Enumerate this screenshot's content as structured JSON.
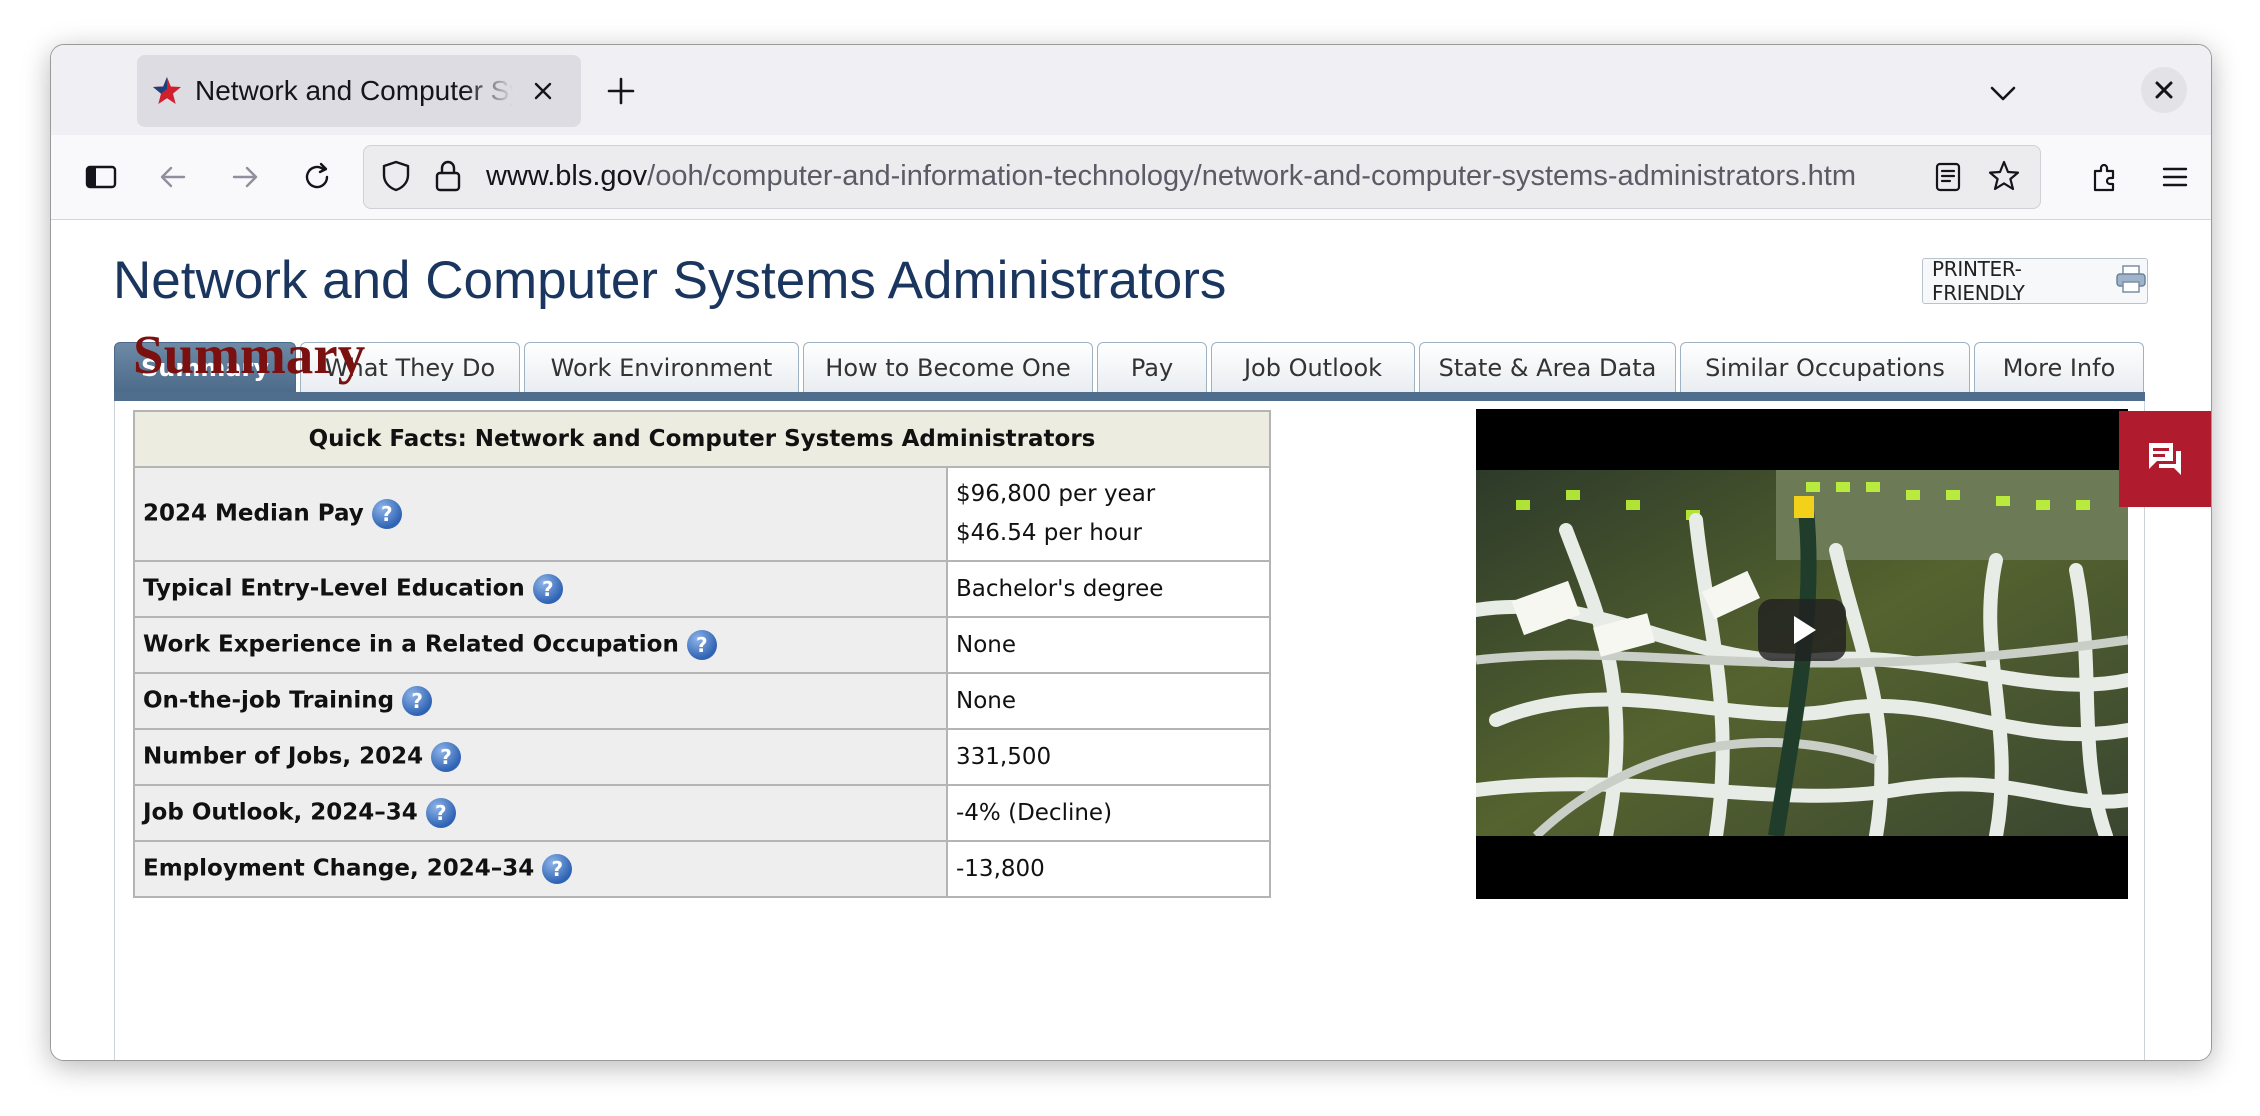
{
  "browser": {
    "tab_title": "Network and Computer Systems Administrators",
    "url_host": "www.bls.gov",
    "url_path": "/ooh/computer-and-information-technology/network-and-computer-systems-administrators.htm",
    "icons": [
      "sidebar-icon",
      "back-icon",
      "forward-icon",
      "reload-icon",
      "shield-icon",
      "lock-icon",
      "reader-view-icon",
      "bookmark-star-icon",
      "extensions-icon",
      "menu-icon",
      "list-all-tabs-icon",
      "close-window-icon",
      "new-tab-icon"
    ]
  },
  "page": {
    "title": "Network and Computer Systems Administrators",
    "printer_friendly": "PRINTER-FRIENDLY",
    "tabs": [
      "Summary",
      "What They Do",
      "Work Environment",
      "How to Become One",
      "Pay",
      "Job Outlook",
      "State & Area Data",
      "Similar Occupations",
      "More Info"
    ],
    "active_tab": "Summary",
    "section_heading": "Summary",
    "quick_facts": {
      "title": "Quick Facts: Network and Computer Systems Administrators",
      "help_glyph": "?",
      "rows": [
        {
          "label": "2024 Median Pay",
          "value": "$96,800 per year",
          "value2": "$46.54 per hour"
        },
        {
          "label": "Typical Entry-Level Education",
          "value": "Bachelor's degree"
        },
        {
          "label": "Work Experience in a Related Occupation",
          "value": "None"
        },
        {
          "label": "On-the-job Training",
          "value": "None"
        },
        {
          "label": "Number of Jobs, 2024",
          "value": "331,500"
        },
        {
          "label": "Job Outlook, 2024–34",
          "value": "-4% (Decline)"
        },
        {
          "label": "Employment Change, 2024–34",
          "value": "-13,800"
        }
      ]
    }
  },
  "colors": {
    "title_blue": "#1a355e",
    "summary_red": "#7a1010",
    "active_tab": "#4c6b8a",
    "chat_red": "#b01c2e"
  }
}
